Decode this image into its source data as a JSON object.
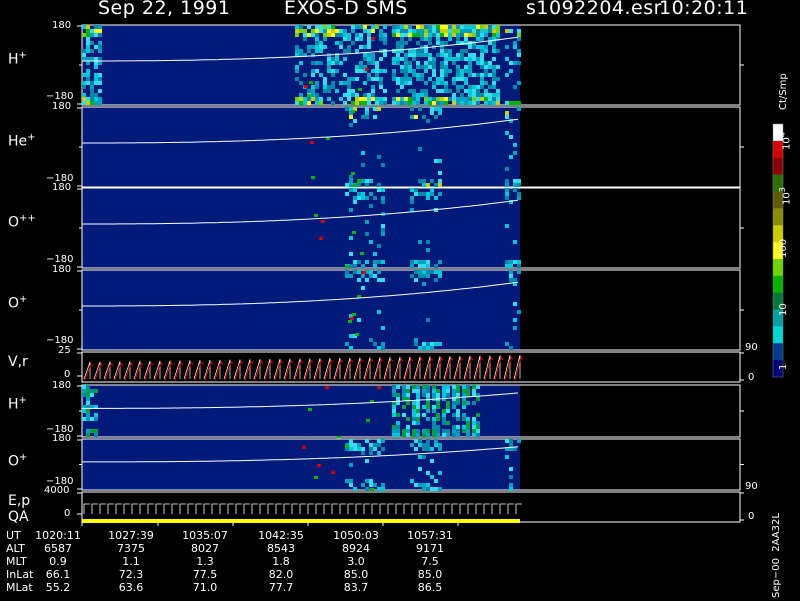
{
  "header": {
    "date": "Sep 22, 1991",
    "instrument": "EXOS-D SMS",
    "file": "s1092204.esr",
    "time": "10:20:11"
  },
  "panels": [
    {
      "id": "p1",
      "species": "H",
      "charge": "+",
      "top_tick": "180",
      "bottom_tick": "−180"
    },
    {
      "id": "p2",
      "species": "He",
      "charge": "+",
      "top_tick": "180",
      "bottom_tick": "−180"
    },
    {
      "id": "p3",
      "species": "O",
      "charge": "++",
      "top_tick": "180",
      "bottom_tick": "−180"
    },
    {
      "id": "p4",
      "species": "O",
      "charge": "+",
      "top_tick": "180",
      "bottom_tick": "−180"
    },
    {
      "id": "p6",
      "species": "H",
      "charge": "+",
      "top_tick": "180",
      "bottom_tick": "−180"
    },
    {
      "id": "p7",
      "species": "O",
      "charge": "+",
      "top_tick": "180",
      "bottom_tick": "−180"
    }
  ],
  "vr_panel": {
    "label": "V,r",
    "top_tick": "25",
    "mid_tick": "0",
    "right_top": "90",
    "right_bottom": "0"
  },
  "ep_panel": {
    "label1": "E,p",
    "label2": "QA",
    "top_tick": "4000",
    "mid_tick": "0",
    "right_top": "90",
    "right_bottom": "0"
  },
  "colorbar": {
    "unit": "Ct/Smp",
    "labels": [
      {
        "base": "10",
        "exp": "4"
      },
      {
        "base": "10",
        "exp": "3"
      },
      {
        "base": "100",
        "exp": ""
      },
      {
        "base": "10",
        "exp": ""
      },
      {
        "base": "1",
        "exp": ""
      }
    ],
    "colors": [
      "#ffffff",
      "#d40000",
      "#8b0000",
      "#2a6f00",
      "#5e5e00",
      "#8c8c00",
      "#cccc00",
      "#ffff00",
      "#6fd400",
      "#00b400",
      "#007a3c",
      "#00a0a0",
      "#00d4d4",
      "#003c8c",
      "#000078"
    ]
  },
  "footer": {
    "rows": [
      {
        "label": "UT",
        "values": [
          "1020:11",
          "1027:39",
          "1035:07",
          "1042:35",
          "1050:03",
          "1057:31"
        ]
      },
      {
        "label": "ALT",
        "values": [
          "6587",
          "7375",
          "8027",
          "8543",
          "8924",
          "9171"
        ]
      },
      {
        "label": "MLT",
        "values": [
          "0.9",
          "1.1",
          "1.3",
          "1.8",
          "3.0",
          "7.5"
        ]
      },
      {
        "label": "InLat",
        "values": [
          "66.1",
          "72.3",
          "77.5",
          "82.0",
          "85.0",
          "85.0"
        ]
      },
      {
        "label": "MLat",
        "values": [
          "55.2",
          "63.6",
          "71.0",
          "77.7",
          "83.7",
          "86.5"
        ]
      }
    ],
    "side_note": "Sep−00  2AA32L"
  },
  "chart_data": {
    "type": "heatmap",
    "title": "Sep 22, 1991   EXOS-D SMS   s1092204.esr  10:20:11",
    "x_axis_ticks": [
      "1020:11",
      "1027:39",
      "1035:07",
      "1042:35",
      "1050:03",
      "1057:31"
    ],
    "panels": [
      {
        "name": "H+",
        "ylim": [
          -180,
          180
        ]
      },
      {
        "name": "He+",
        "ylim": [
          -180,
          180
        ]
      },
      {
        "name": "O++",
        "ylim": [
          -180,
          180
        ]
      },
      {
        "name": "O+",
        "ylim": [
          -180,
          180
        ]
      },
      {
        "name": "V,r",
        "ylim": [
          0,
          25
        ],
        "right_ylim": [
          0,
          90
        ]
      },
      {
        "name": "H+",
        "ylim": [
          -180,
          180
        ]
      },
      {
        "name": "O+",
        "ylim": [
          -180,
          180
        ]
      },
      {
        "name": "E,p",
        "ylim": [
          0,
          4000
        ],
        "right_ylim": [
          0,
          90
        ]
      }
    ],
    "color_scale": {
      "unit": "Ct/Smp",
      "scale": "log",
      "range": [
        1,
        10000
      ]
    }
  }
}
